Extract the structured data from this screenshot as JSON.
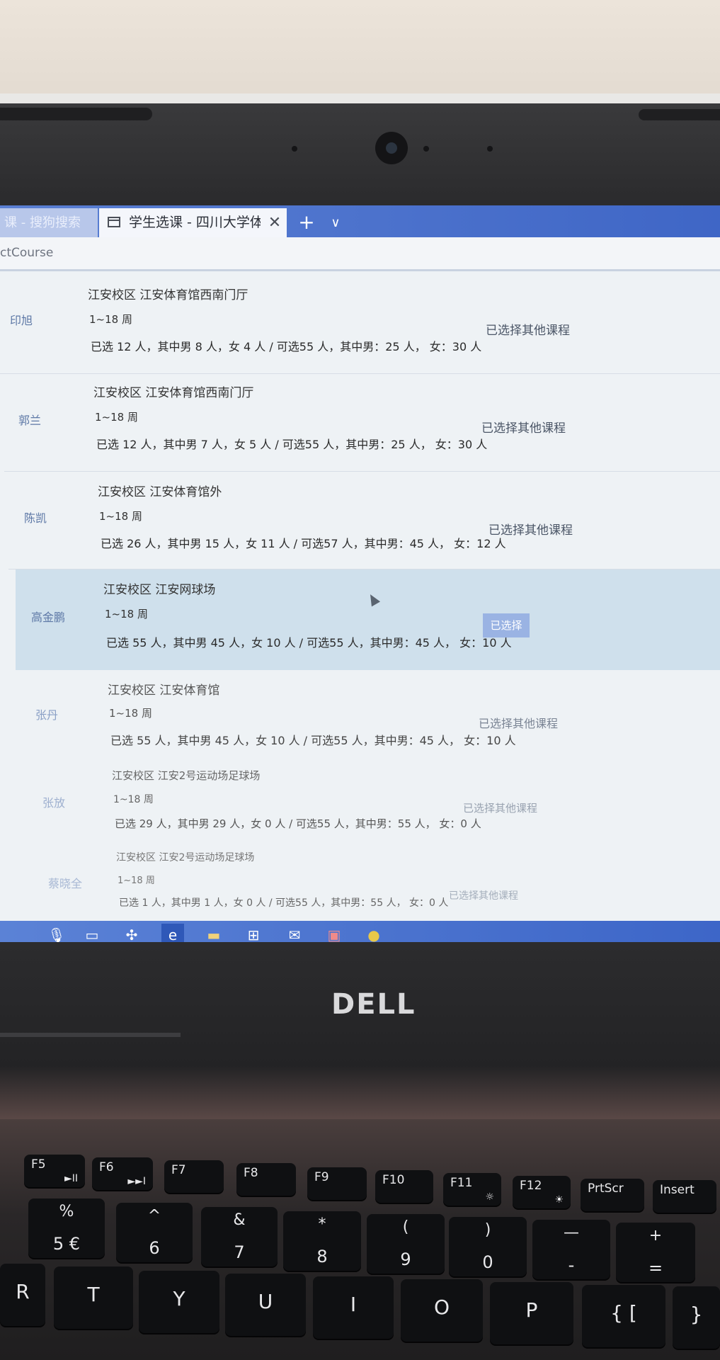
{
  "browser": {
    "prev_tab_title": "课 - 搜狗搜索",
    "active_tab_title": "学生选课 - 四川大学体育",
    "tab_close": "✕",
    "new_tab": "+",
    "tab_menu": "∨",
    "address": "ctCourse"
  },
  "rows": [
    {
      "teacher": "印旭",
      "venue": "江安校区 江安体育馆西南门厅",
      "weeks": "1~18 周",
      "stats": "已选 12 人，其中男 8 人，女 4 人 / 可选55 人，其中男：25 人， 女：30 人",
      "status": "已选择其他课程"
    },
    {
      "teacher": "郭兰",
      "venue": "江安校区 江安体育馆西南门厅",
      "weeks": "1~18 周",
      "stats": "已选 12 人，其中男 7 人，女 5 人 / 可选55 人，其中男：25 人， 女：30 人",
      "status": "已选择其他课程"
    },
    {
      "teacher": "陈凯",
      "venue": "江安校区 江安体育馆外",
      "weeks": "1~18 周",
      "stats": "已选 26 人，其中男 15 人，女 11 人 / 可选57 人，其中男：45 人， 女：12 人",
      "status": "已选择其他课程"
    },
    {
      "teacher": "高金鹏",
      "venue": "江安校区 江安网球场",
      "weeks": "1~18 周",
      "stats": "已选 55 人，其中男 45 人，女 10 人 / 可选55 人，其中男：45 人， 女：10 人",
      "status": "已选择"
    },
    {
      "teacher": "张丹",
      "venue": "江安校区 江安体育馆",
      "weeks": "1~18 周",
      "stats": "已选 55 人，其中男 45 人，女 10 人 / 可选55 人，其中男：45 人， 女：10 人",
      "status": "已选择其他课程"
    },
    {
      "teacher": "张放",
      "venue": "江安校区 江安2号运动场足球场",
      "weeks": "1~18 周",
      "stats": "已选 29 人，其中男 29 人，女 0 人 / 可选55 人，其中男：55 人， 女：0 人",
      "status": "已选择其他课程"
    },
    {
      "teacher": "蔡晓全",
      "venue": "江安校区 江安2号运动场足球场",
      "weeks": "1~18 周",
      "stats": "已选 1 人，其中男 1 人，女 0 人 / 可选55 人，其中男：55 人， 女：0 人",
      "status": "已选择其他课程"
    }
  ],
  "taskbar": {
    "icons": [
      "microphone-icon",
      "task-view-icon",
      "app-icon",
      "edge-icon",
      "file-explorer-icon",
      "store-icon",
      "mail-icon",
      "app-icon",
      "app-icon"
    ]
  },
  "laptop": {
    "brand": "DELL"
  },
  "keyboard": {
    "fn_row": [
      {
        "label": "F5",
        "sub": "►II"
      },
      {
        "label": "F6",
        "sub": "►►I"
      },
      {
        "label": "F7",
        "sub": ""
      },
      {
        "label": "F8",
        "sub": ""
      },
      {
        "label": "F9",
        "sub": ""
      },
      {
        "label": "F10",
        "sub": ""
      },
      {
        "label": "F11",
        "sub": "☼"
      },
      {
        "label": "F12",
        "sub": "☀"
      },
      {
        "label": "PrtScr",
        "sub": ""
      },
      {
        "label": "Insert",
        "sub": ""
      }
    ],
    "num_row": [
      {
        "top": "%",
        "bottom": "5 €"
      },
      {
        "top": "^",
        "bottom": "6"
      },
      {
        "top": "&",
        "bottom": "7"
      },
      {
        "top": "*",
        "bottom": "8"
      },
      {
        "top": "(",
        "bottom": "9"
      },
      {
        "top": ")",
        "bottom": "0"
      },
      {
        "top": "—",
        "bottom": "-"
      },
      {
        "top": "+",
        "bottom": "="
      }
    ],
    "letter_row": [
      {
        "main": "R"
      },
      {
        "main": "T"
      },
      {
        "main": "Y"
      },
      {
        "main": "U"
      },
      {
        "main": "I"
      },
      {
        "main": "O"
      },
      {
        "main": "P"
      },
      {
        "main": "{ ["
      },
      {
        "main": "}"
      }
    ]
  }
}
